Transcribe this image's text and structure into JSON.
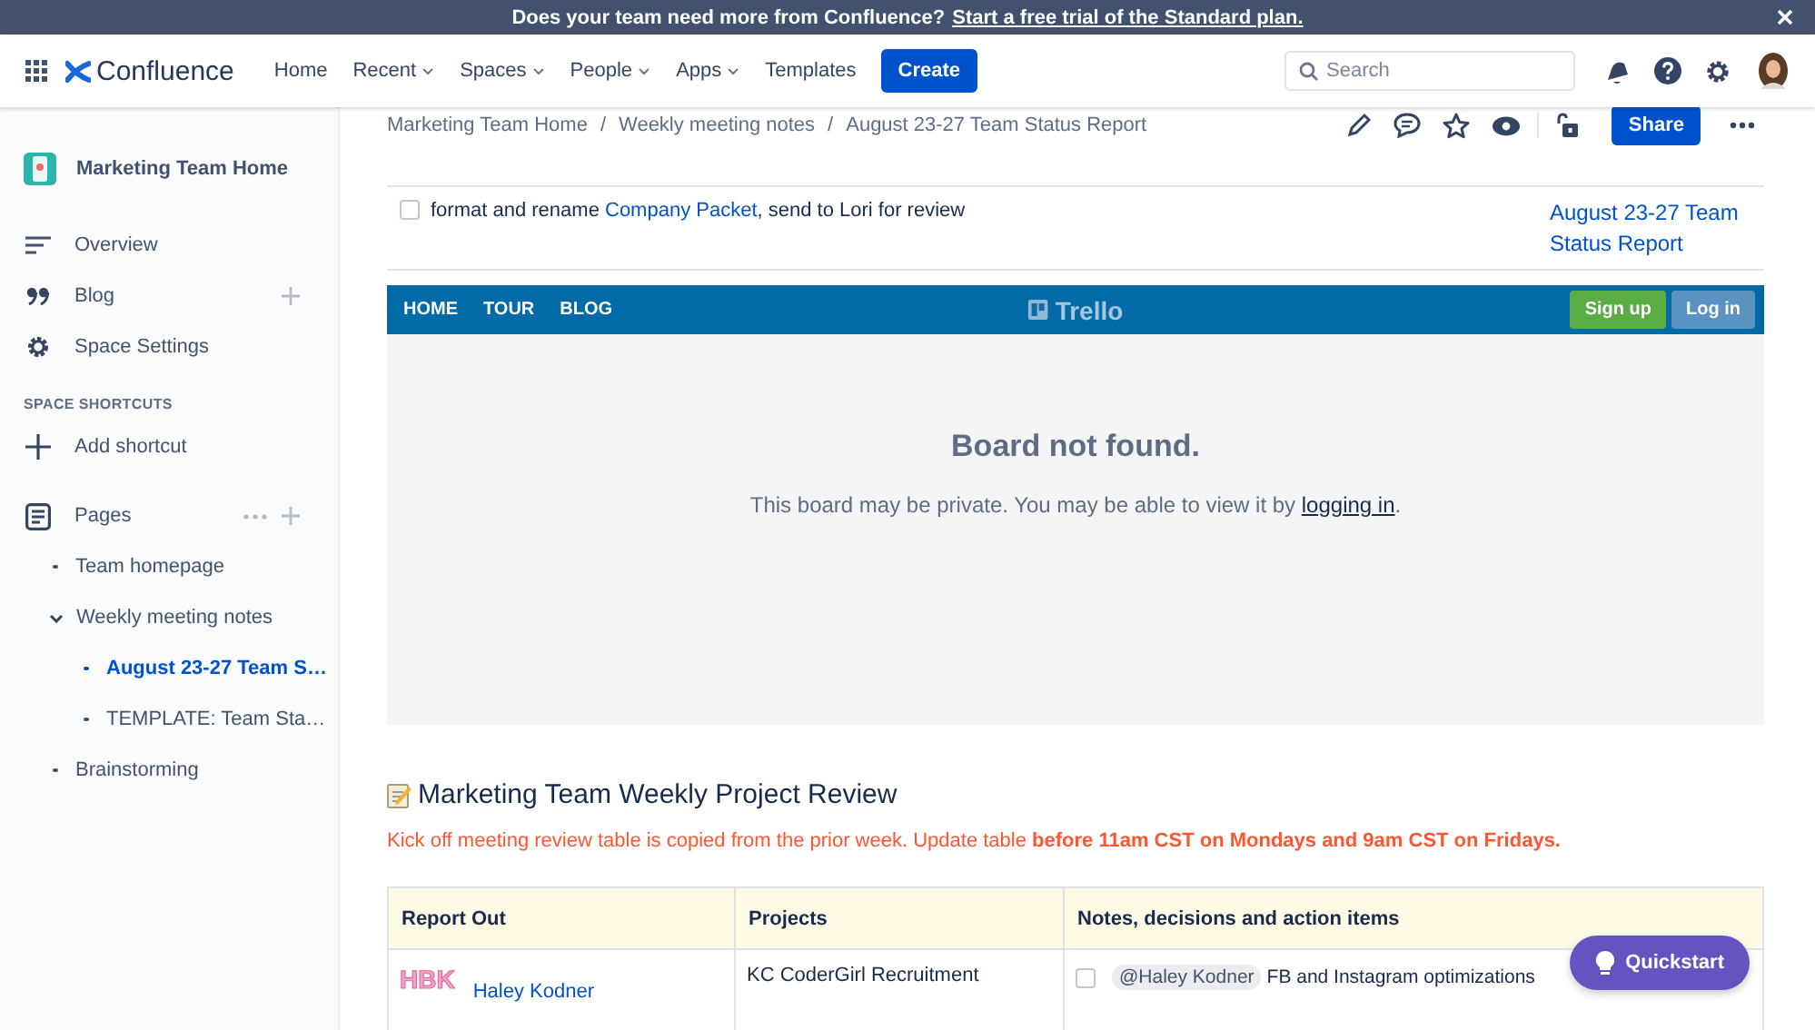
{
  "banner": {
    "text": "Does your team need more from Confluence?",
    "link": "Start a free trial of the Standard plan."
  },
  "nav": {
    "brand": "Confluence",
    "items": [
      {
        "label": "Home",
        "dropdown": false
      },
      {
        "label": "Recent",
        "dropdown": true
      },
      {
        "label": "Spaces",
        "dropdown": true
      },
      {
        "label": "People",
        "dropdown": true
      },
      {
        "label": "Apps",
        "dropdown": true
      },
      {
        "label": "Templates",
        "dropdown": false
      }
    ],
    "create": "Create",
    "search": {
      "placeholder": "Search"
    }
  },
  "sidebar": {
    "space": "Marketing Team Home",
    "items": [
      {
        "label": "Overview",
        "addable": false
      },
      {
        "label": "Blog",
        "addable": true
      },
      {
        "label": "Space Settings",
        "addable": false
      }
    ],
    "shortcuts_heading": "SPACE SHORTCUTS",
    "add_shortcut": "Add shortcut",
    "pages_label": "Pages",
    "pages": [
      {
        "label": "Team homepage",
        "selected": false,
        "expanded": false
      },
      {
        "label": "Weekly meeting notes",
        "selected": false,
        "expanded": true,
        "children": [
          {
            "label": "August 23-27 Team S…",
            "selected": true,
            "expanded": false
          },
          {
            "label": "TEMPLATE: Team Sta…",
            "selected": false,
            "expanded": false
          }
        ]
      },
      {
        "label": "Brainstorming",
        "selected": false,
        "expanded": false
      }
    ]
  },
  "breadcrumbs": {
    "separator": "/",
    "items": [
      "Marketing Team Home",
      "Weekly meeting notes",
      "August 23-27 Team Status Report"
    ]
  },
  "share": "Share",
  "task": {
    "checked": false,
    "before": "format and rename ",
    "link": "Company Packet",
    "after": ", send to Lori for review",
    "page_link": "August 23-27 Team Status Report"
  },
  "trello": {
    "nav": [
      "HOME",
      "TOUR",
      "BLOG"
    ],
    "brand": "Trello",
    "signup": "Sign up",
    "login": "Log in",
    "heading": "Board not found.",
    "message": "This board may be private. You may be able to view it by ",
    "message_link": "logging in",
    "message_end": "."
  },
  "section_title": "Marketing Team Weekly Project Review",
  "notice": "Kick off meeting review table is copied from the prior week. Update table **before 11am CST on Mondays and 9am CST on Fridays.**",
  "table": {
    "columns": [
      "Report Out",
      "Projects",
      "Notes, decisions and action items"
    ],
    "rows": [
      {
        "initials": "HBK",
        "name": "Haley Kodner",
        "project": "KC CoderGirl Recruitment",
        "task": {
          "checked": false,
          "mention": "@Haley Kodner",
          "text": "FB and Instagram optimizations"
        }
      }
    ]
  },
  "quickstart": "Quickstart"
}
